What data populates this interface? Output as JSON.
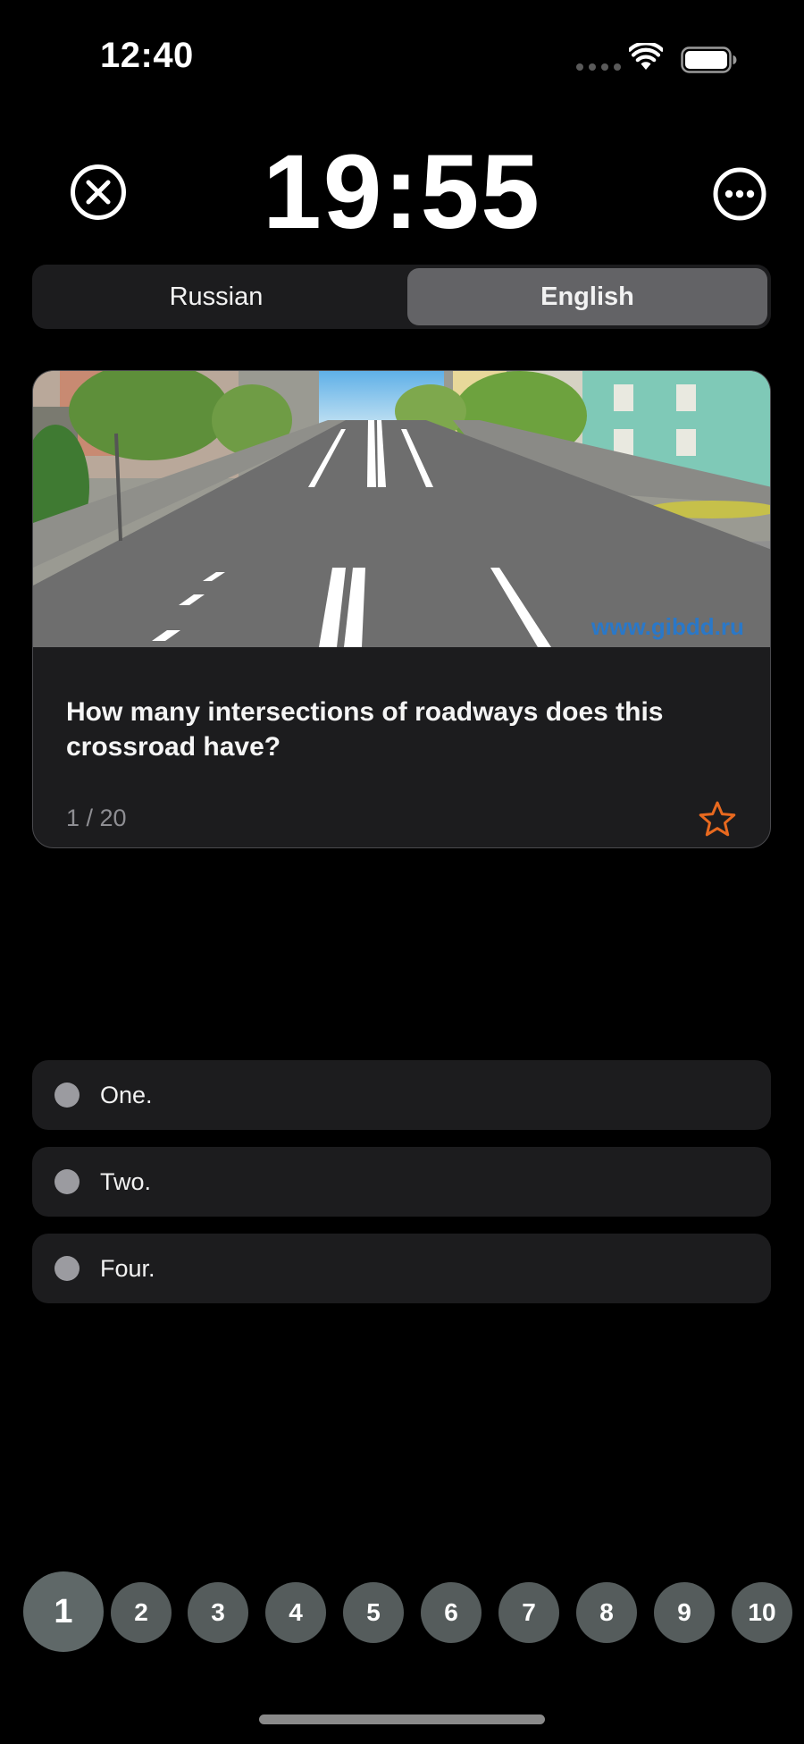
{
  "status_bar": {
    "time": "12:40"
  },
  "header": {
    "timer": "19:55",
    "close_icon": "close-circle-icon",
    "more_icon": "ellipsis-circle-icon"
  },
  "language_toggle": {
    "options": [
      "Russian",
      "English"
    ],
    "selected": "English"
  },
  "question": {
    "image_watermark": "www.gibdd.ru",
    "text": "How many intersections of roadways does this crossroad have?",
    "counter": "1 / 20",
    "favorite_icon": "star-icon"
  },
  "answers": [
    {
      "label": "One."
    },
    {
      "label": "Two."
    },
    {
      "label": "Four."
    }
  ],
  "pager": {
    "pages": [
      "1",
      "2",
      "3",
      "4",
      "5",
      "6",
      "7",
      "8",
      "9",
      "10"
    ],
    "current": "1"
  },
  "colors": {
    "background": "#000000",
    "card": "#1c1c1e",
    "selected_segment": "#636366",
    "star_accent": "#e8691f",
    "pager_bubble": "#555c5c"
  }
}
